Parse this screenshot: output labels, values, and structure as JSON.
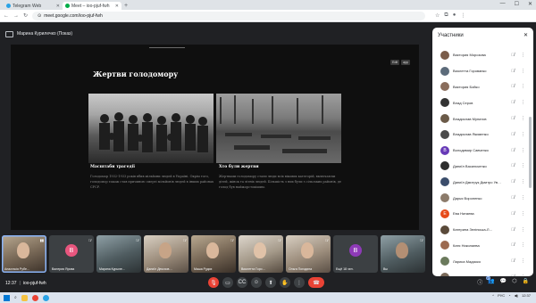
{
  "browser": {
    "tabs": [
      {
        "title": "Telegram Web",
        "color": "#2aa3e6",
        "active": false
      },
      {
        "title": "Meet – ioo-pjuf-fwh",
        "color": "#00ac47",
        "active": true
      }
    ],
    "url": "meet.google.com/ioo-pjuf-fwh"
  },
  "meet": {
    "presenter": "Марина Курилечко (Показ)",
    "slide": {
      "title": "Жертви голодомору",
      "cards": [
        {
          "heading": "Масштаби трагедії",
          "text": "Голодомор 1932-1933 років вбив мільйони людей в Україні. Окрім того, голодомор також став причиною смерті мільйонів людей в інших районах СРСР."
        },
        {
          "heading": "Хто були жертви",
          "text": "Жертвами голодомору стали люди всіх вікових категорій, включаючи дітей, жінок та літніх людей. Більшість з них були з сільських районів, де голод був найжорстокішим."
        }
      ],
      "btn1": "Edit",
      "btn2": "app"
    },
    "tiles": [
      {
        "name": "Анастасія Рубе…",
        "type": "cam",
        "speaking": true
      },
      {
        "name": "Валерия Ярова",
        "type": "avatar",
        "letter": "В",
        "color": "#e8567e"
      },
      {
        "name": "Марина Курыле…",
        "type": "cam3"
      },
      {
        "name": "Даниїл Дексхов…",
        "type": "cam4"
      },
      {
        "name": "Маша Рудих",
        "type": "cam"
      },
      {
        "name": "Виолетта Горо…",
        "type": "cam2"
      },
      {
        "name": "Ольга Погодина",
        "type": "cam4"
      },
      {
        "name": "Ещё 18 чел.",
        "type": "avatar",
        "letter": "В",
        "color": "#8e3ab7"
      },
      {
        "name": "Вы",
        "type": "cam3"
      }
    ],
    "time": "12:37",
    "code": "ioo-pjuf-fwh",
    "participants_title": "Участники",
    "badge": "27",
    "participants": [
      {
        "name": "Виктория Морозова",
        "color": "#7a5c4a"
      },
      {
        "name": "Виолетта Горованко",
        "color": "#5c6b7a"
      },
      {
        "name": "Виктория Бойко",
        "color": "#8a6d5c"
      },
      {
        "name": "Влад Серов",
        "color": "#333333"
      },
      {
        "name": "Владислав Мунатов",
        "color": "#6b5a48"
      },
      {
        "name": "Владислав Якименко",
        "color": "#4a4a4a"
      },
      {
        "name": "Володимир Савченко",
        "color": "#673ab7",
        "letter": "В"
      },
      {
        "name": "Даниїл Васильченко",
        "color": "#2d2d2d"
      },
      {
        "name": "Даниїл Дмитрук Дмитро Ув…",
        "color": "#3b4d6b"
      },
      {
        "name": "Дарья Вороненко",
        "color": "#8c7b6b"
      },
      {
        "name": "Ева Натаева",
        "color": "#e64a19",
        "letter": "Е"
      },
      {
        "name": "Катерина Зелінська-Л…",
        "color": "#5a4a3a"
      },
      {
        "name": "Катя Николаева",
        "color": "#9c6a50"
      },
      {
        "name": "Лариса Мадаоко",
        "color": "#6b7a5c"
      },
      {
        "name": "Маша Рудих",
        "color": "#7a6a5a"
      }
    ]
  },
  "taskbar": {
    "lang": "РУС",
    "clock": "12:37"
  }
}
